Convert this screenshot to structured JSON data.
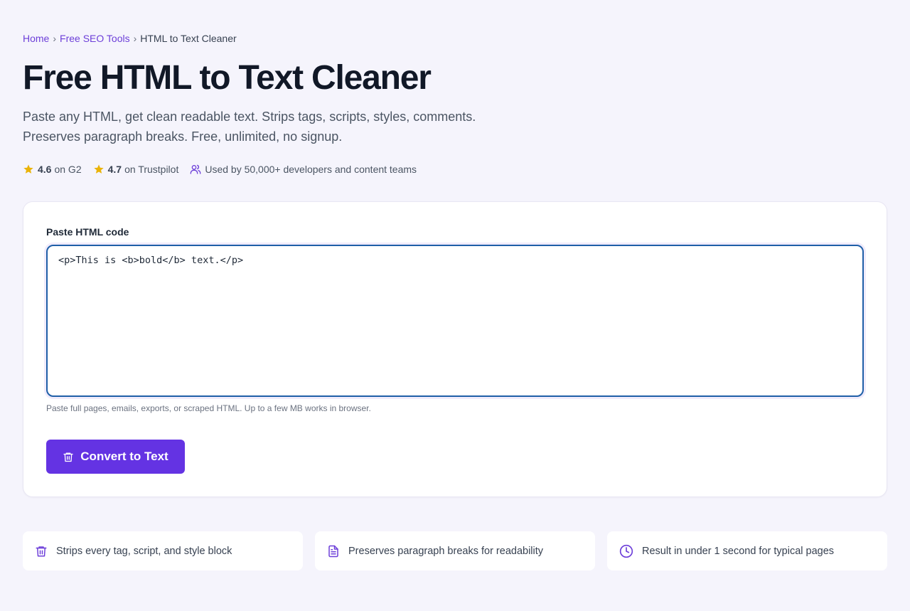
{
  "breadcrumb": {
    "home": "Home",
    "sep1": "›",
    "tools": "Free SEO Tools",
    "sep2": "›",
    "current": "HTML to Text Cleaner"
  },
  "page": {
    "title": "Free HTML to Text Cleaner",
    "subtitle": "Paste any HTML, get clean readable text. Strips tags, scripts, styles, comments. Preserves paragraph breaks. Free, unlimited, no signup."
  },
  "ratings": {
    "g2": {
      "score": "4.6",
      "label": "on G2",
      "icon": "star-icon"
    },
    "trustpilot": {
      "score": "4.7",
      "label": "on Trustpilot",
      "icon": "star-icon"
    },
    "usage": {
      "text": "Used by 50,000+ developers and content teams",
      "icon": "users-icon"
    }
  },
  "form": {
    "label": "Paste HTML code",
    "value": "<p>This is <b>bold</b> text.</p>",
    "hint": "Paste full pages, emails, exports, or scraped HTML. Up to a few MB works in browser.",
    "button_label": "Convert to Text",
    "button_icon": "trash-icon"
  },
  "features": [
    {
      "icon": "trash-icon",
      "text": "Strips every tag, script, and style block"
    },
    {
      "icon": "document-icon",
      "text": "Preserves paragraph breaks for readability"
    },
    {
      "icon": "clock-icon",
      "text": "Result in under 1 second for typical pages"
    }
  ],
  "colors": {
    "accent": "#6433e3",
    "link": "#6d3fd9",
    "star": "#eab308",
    "background": "#f5f4fc",
    "focus_border": "#1f5fa8"
  }
}
